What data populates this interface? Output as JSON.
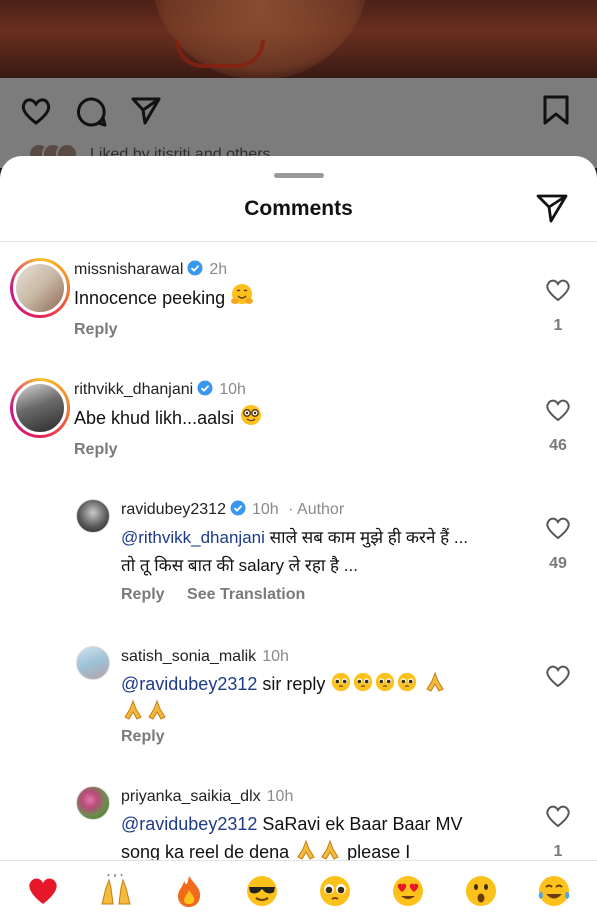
{
  "post": {
    "liked_by_text": "Liked by itisriti and others"
  },
  "sheet": {
    "title": "Comments"
  },
  "comments": [
    {
      "username": "missnisharawal",
      "time": "2h",
      "verified": true,
      "text": "Innocence peeking",
      "emoji": "hugging-face",
      "likes": "1",
      "reply_label": "Reply"
    },
    {
      "username": "rithvikk_dhanjani",
      "time": "10h",
      "verified": true,
      "text": "Abe khud likh...aalsi",
      "emoji": "nerd-face",
      "likes": "46",
      "reply_label": "Reply"
    },
    {
      "username": "ravidubey2312",
      "time": "10h",
      "author_tag": "· Author",
      "verified": true,
      "mention": "@rithvikk_dhanjani",
      "text_line1": "साले सब काम मुझे ही करने हैं ...",
      "text_line2": "तो तू किस बात की salary ले रहा है ...",
      "likes": "49",
      "reply_label": "Reply",
      "translate_label": "See Translation"
    },
    {
      "username": "satish_sonia_malik",
      "time": "10h",
      "verified": false,
      "mention": "@ravidubey2312",
      "text": "sir  reply",
      "reply_label": "Reply"
    },
    {
      "username": "priyanka_saikia_dlx",
      "time": "10h",
      "verified": false,
      "mention": "@ravidubey2312",
      "text_line1": "SaRavi ek Baar Baar MV",
      "text_line2": "song ka reel de dena",
      "text_line2_tail": "please I",
      "likes": "1"
    }
  ],
  "reaction_bar": [
    "red-heart",
    "raising-hands",
    "fire",
    "sunglasses-face",
    "pleading-face",
    "heart-eyes-face",
    "astonished-face",
    "tears-of-joy-face"
  ],
  "colors": {
    "accent_blue": "#3897f0",
    "mention": "#1e3a8a",
    "muted": "#7a7a7a"
  }
}
